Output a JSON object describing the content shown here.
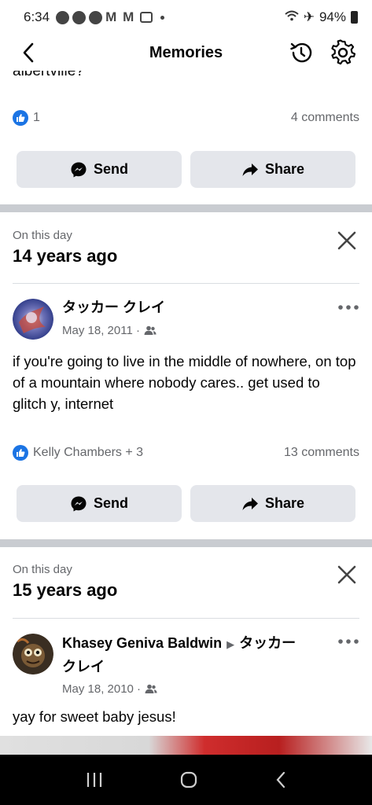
{
  "status_bar": {
    "time": "6:34",
    "battery": "94%"
  },
  "header": {
    "title": "Memories",
    "back_icon": "chevron-left-icon",
    "history_icon": "history-icon",
    "settings_icon": "gear-icon"
  },
  "previous_post": {
    "cutoff_text": "albertville?",
    "like_count": "1",
    "comments": "4 comments",
    "send_label": "Send",
    "share_label": "Share"
  },
  "memories": [
    {
      "label": "On this day",
      "title": "14 years ago",
      "author": "タッカー クレイ",
      "date": "May 18, 2011 ·",
      "text": "if you're going to live in the middle of nowhere, on top of a mountain where nobody cares..  get used to glitch y,  internet",
      "reactors": "Kelly Chambers + 3",
      "comments": "13 comments",
      "send_label": "Send",
      "share_label": "Share"
    },
    {
      "label": "On this day",
      "title": "15 years ago",
      "author": "Khasey Geniva Baldwin",
      "author_target_line1": "タッカー",
      "author_target_line2": "クレイ",
      "date": "May 18, 2010 ·",
      "text": "yay for sweet baby jesus!"
    }
  ],
  "colors": {
    "brand_blue": "#1b74e4",
    "button_gray": "#e4e6eb",
    "secondary_text": "#65676b",
    "divider": "#c9ccd1"
  }
}
